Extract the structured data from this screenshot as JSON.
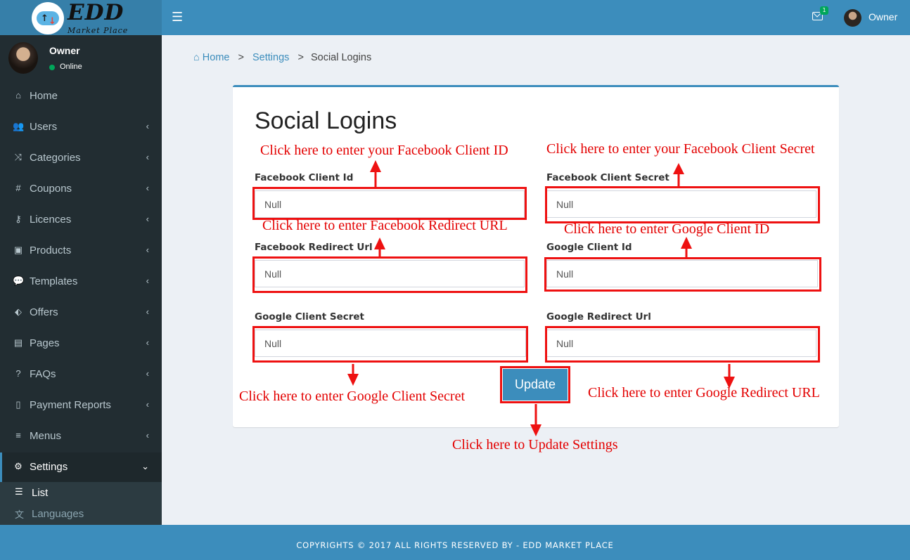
{
  "brand": {
    "title": "EDD",
    "subtitle": "Market Place",
    "logo_icon": "cloud-upload-download-icon"
  },
  "topbar": {
    "menu_icon": "hamburger-icon",
    "mail_badge": "1",
    "user_name": "Owner"
  },
  "sidebar": {
    "user_name": "Owner",
    "status": "Online",
    "items": [
      {
        "label": "Home",
        "icon": "home-icon",
        "glyph": "⌂",
        "has_chevron": false
      },
      {
        "label": "Users",
        "icon": "users-icon",
        "glyph": "👥",
        "has_chevron": true
      },
      {
        "label": "Categories",
        "icon": "random-icon",
        "glyph": "⤨",
        "has_chevron": true
      },
      {
        "label": "Coupons",
        "icon": "hashtag-icon",
        "glyph": "#",
        "has_chevron": true
      },
      {
        "label": "Licences",
        "icon": "key-icon",
        "glyph": "⚷",
        "has_chevron": true
      },
      {
        "label": "Products",
        "icon": "briefcase-icon",
        "glyph": "▣",
        "has_chevron": true
      },
      {
        "label": "Templates",
        "icon": "comment-icon",
        "glyph": "💬",
        "has_chevron": true
      },
      {
        "label": "Offers",
        "icon": "tags-icon",
        "glyph": "⬖",
        "has_chevron": true
      },
      {
        "label": "Pages",
        "icon": "file-text-icon",
        "glyph": "▤",
        "has_chevron": true
      },
      {
        "label": "FAQs",
        "icon": "question-icon",
        "glyph": "?",
        "has_chevron": true
      },
      {
        "label": "Payment Reports",
        "icon": "file-icon",
        "glyph": "▯",
        "has_chevron": true
      },
      {
        "label": "Menus",
        "icon": "bars-icon",
        "glyph": "≡",
        "has_chevron": true
      },
      {
        "label": "Settings",
        "icon": "gear-icon",
        "glyph": "⚙",
        "has_chevron": true,
        "active": true
      }
    ],
    "submenu": [
      {
        "label": "List",
        "icon": "list-icon",
        "glyph": "☰"
      },
      {
        "label": "Languages",
        "icon": "language-icon",
        "glyph": "文"
      }
    ]
  },
  "breadcrumb": {
    "home": "Home",
    "settings": "Settings",
    "current": "Social Logins",
    "separator": ">"
  },
  "form": {
    "title": "Social Logins",
    "fields": {
      "fb_client_id": {
        "label": "Facebook Client Id",
        "placeholder": "Null"
      },
      "fb_client_secret": {
        "label": "Facebook Client Secret",
        "placeholder": "Null"
      },
      "fb_redirect_url": {
        "label": "Facebook Redirect Url",
        "placeholder": "Null"
      },
      "google_client_id": {
        "label": "Google Client Id",
        "placeholder": "Null"
      },
      "google_client_secret": {
        "label": "Google Client Secret",
        "placeholder": "Null"
      },
      "google_redirect_url": {
        "label": "Google Redirect Url",
        "placeholder": "Null"
      }
    },
    "update_label": "Update"
  },
  "annotations": {
    "fb_client_id": "Click here to enter your Facebook Client ID",
    "fb_client_secret": "Click here to enter your Facebook Client Secret",
    "fb_redirect_url": "Click here to enter Facebook Redirect URL",
    "google_client_id": "Click here to enter Google Client ID",
    "google_client_secret": "Click here to enter Google Client Secret",
    "google_redirect_url": "Click here to enter Google Redirect URL",
    "update": "Click here to Update Settings"
  },
  "footer": {
    "text": "COPYRIGHTS © 2017 ALL RIGHTS RESERVED BY - EDD MARKET PLACE"
  },
  "colors": {
    "primary": "#3c8dbc",
    "sidebar": "#222d32",
    "annotation_red": "#e30000",
    "online": "#00a65a"
  }
}
